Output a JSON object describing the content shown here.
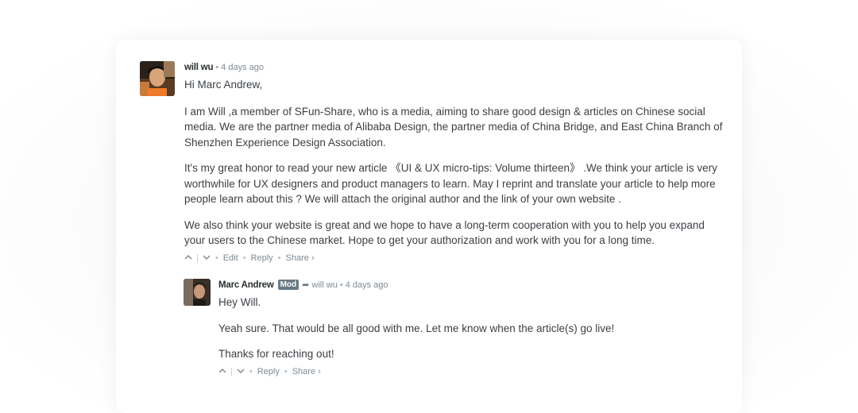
{
  "comments": [
    {
      "author": "will wu",
      "time": "4 days ago",
      "paragraphs": [
        "Hi Marc Andrew,",
        "I am Will ,a member of SFun-Share, who is a media, aiming to share good design & articles on Chinese social media. We are the partner media of Alibaba Design, the partner media of China Bridge, and East China Branch of Shenzhen Experience Design Association.",
        "It's my great honor to read your new article 《UI & UX micro-tips: Volume thirteen》 .We think your article is very worthwhile for UX designers and product managers to learn. May I reprint and translate your article to help more people learn about this ? We will attach the original author and the link of your own website .",
        "We also think your website is great and we hope to have a long-term cooperation with you to help you expand your users to the Chinese market. Hope to get your authorization and work with you for a long time."
      ],
      "actions": {
        "upvote": "^",
        "downvote": "v",
        "edit": "Edit",
        "reply": "Reply",
        "share": "Share ›"
      }
    },
    {
      "author": "Marc Andrew",
      "badge": "Mod",
      "reply_to": "will wu",
      "time": "4 days ago",
      "paragraphs": [
        "Hey Will.",
        "Yeah sure. That would be all good with me. Let me know when the article(s) go live!",
        "Thanks for reaching out!"
      ],
      "actions": {
        "upvote": "^",
        "downvote": "v",
        "reply": "Reply",
        "share": "Share ›"
      }
    }
  ],
  "icons": {
    "upvote": "chevron-up-icon",
    "downvote": "chevron-down-icon",
    "reply_arrow": "reply-arrow-icon"
  },
  "colors": {
    "badge_bg": "#687a86",
    "meta_text": "#7f8a93",
    "body_text": "#3b3f44"
  }
}
